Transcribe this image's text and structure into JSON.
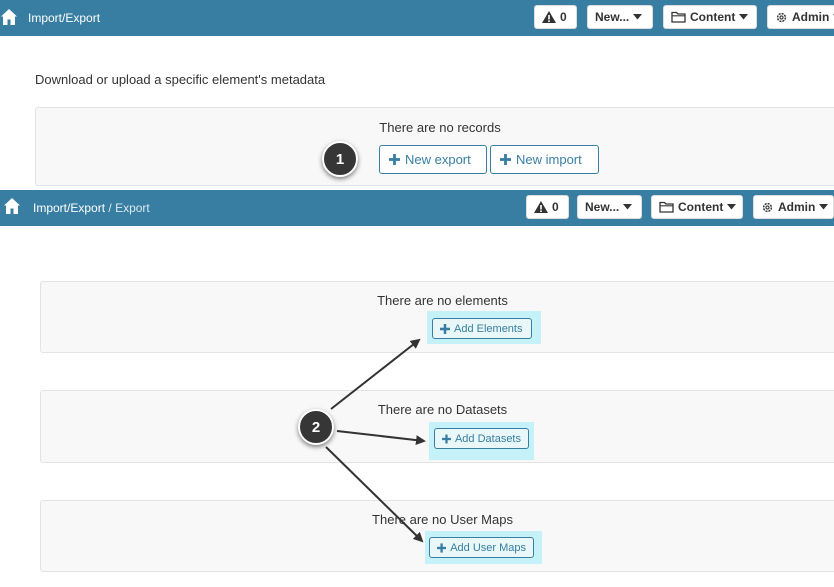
{
  "colors": {
    "header_bg": "#387ea3",
    "accent": "#387ea3",
    "highlight": "#c4f2f8",
    "panel_bg": "#f8f8f8",
    "callout_bg": "#363636"
  },
  "screen1": {
    "breadcrumb": {
      "root": "Import/Export"
    },
    "toolbar": {
      "alerts_count": "0",
      "new_label": "New...",
      "content_label": "Content",
      "admin_label": "Admin"
    },
    "intro": "Download or upload a specific element's metadata",
    "panel": {
      "message": "There are no records",
      "new_export_label": "New export",
      "new_import_label": "New import"
    },
    "callout": "1"
  },
  "screen2": {
    "breadcrumb": {
      "root": "Import/Export",
      "separator": "/",
      "current": "Export"
    },
    "toolbar": {
      "alerts_count": "0",
      "new_label": "New...",
      "content_label": "Content",
      "admin_label": "Admin"
    },
    "sections": [
      {
        "message": "There are no elements",
        "button_label": "Add Elements"
      },
      {
        "message": "There are no Datasets",
        "button_label": "Add Datasets"
      },
      {
        "message": "There are no User Maps",
        "button_label": "Add User Maps"
      }
    ],
    "callout": "2"
  },
  "icons": {
    "home": "home-icon",
    "alert": "warning-icon",
    "dropdown": "caret-down-icon",
    "content": "folder-icon",
    "admin": "gear-icon",
    "add": "plus-icon"
  }
}
